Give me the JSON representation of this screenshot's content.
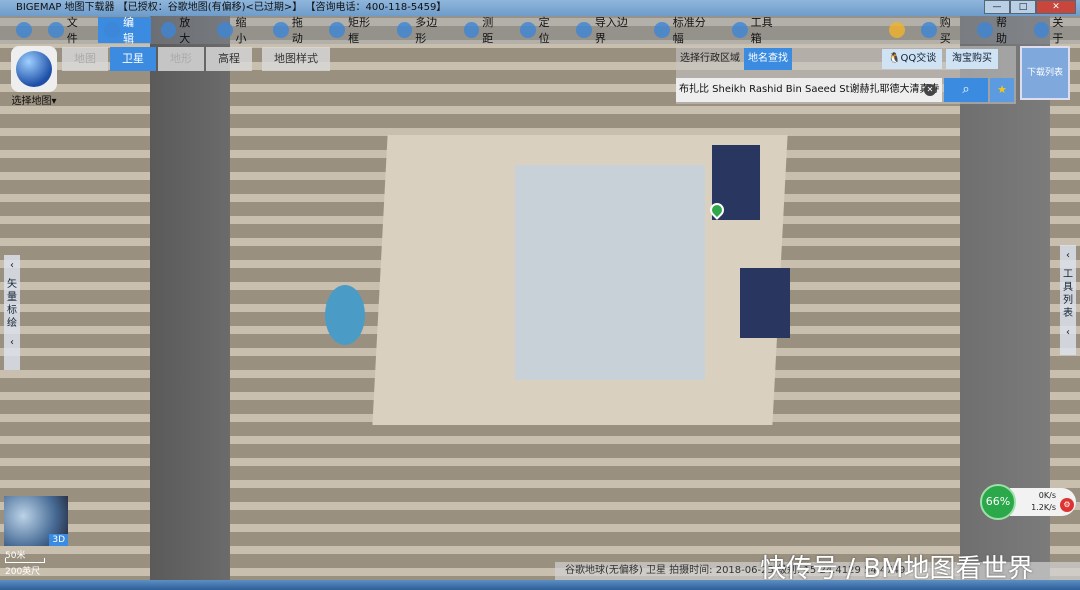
{
  "window": {
    "title": "BIGEMAP 地图下载器 【已授权：谷歌地图(有偏移)<已过期>】 【咨询电话：400-118-5459】",
    "minimize": "—",
    "maximize": "□",
    "close": "✕"
  },
  "toolbar": {
    "items": [
      {
        "label": "文件",
        "icon": "folder-icon"
      },
      {
        "label": "编辑",
        "icon": "edit-icon",
        "active": true
      },
      {
        "label": "放大",
        "icon": "zoom-in-icon"
      },
      {
        "label": "缩小",
        "icon": "zoom-out-icon"
      },
      {
        "label": "拖动",
        "icon": "hand-icon"
      },
      {
        "label": "矩形框",
        "icon": "rectangle-icon"
      },
      {
        "label": "多边形",
        "icon": "polygon-icon"
      },
      {
        "label": "测距",
        "icon": "ruler-icon"
      },
      {
        "label": "定位",
        "icon": "location-icon"
      },
      {
        "label": "导入边界",
        "icon": "import-icon"
      },
      {
        "label": "标准分幅",
        "icon": "grid-icon"
      },
      {
        "label": "工具箱",
        "icon": "toolbox-icon"
      }
    ],
    "right_items": [
      {
        "label": "购买",
        "icon": "cart-icon"
      },
      {
        "label": "帮助",
        "icon": "help-icon"
      },
      {
        "label": "关于",
        "icon": "info-icon"
      }
    ]
  },
  "map_select": {
    "label": "选择地图"
  },
  "map_types": [
    {
      "label": "地图",
      "state": "disabled"
    },
    {
      "label": "卫星",
      "state": "active"
    },
    {
      "label": "地形",
      "state": "disabled"
    },
    {
      "label": "高程",
      "state": "normal"
    },
    {
      "label": "地图样式",
      "state": "normal"
    }
  ],
  "search": {
    "tabs": [
      {
        "label": "选择行政区域"
      },
      {
        "label": "地名查找",
        "active": true
      }
    ],
    "qq": "QQ交谈",
    "taobao": "淘宝购买",
    "value": "布扎比 Sheikh Rashid Bin Saeed St谢赫扎耶德大清真寺",
    "clear": "✕",
    "search_icon": "search-icon",
    "favorite_icon": "star-icon"
  },
  "download_list": "下载列表",
  "left_panel": "矢量标绘",
  "right_panel": "工具列表",
  "minimap": {
    "badge": "3D"
  },
  "scale": {
    "top": "50米",
    "bottom": "200英尺"
  },
  "speed": {
    "percent": "66%",
    "up": "0K/s",
    "down": "1.2K/s"
  },
  "status": "谷歌地球(无偏移) 卫星   拍摄时间: 2018-06-25   级别: 15   24.4129  54.4749",
  "watermark": "快传号 / BM地图看世界",
  "colors": {
    "accent": "#3b8be0",
    "speed_ok": "#2aa84a"
  }
}
